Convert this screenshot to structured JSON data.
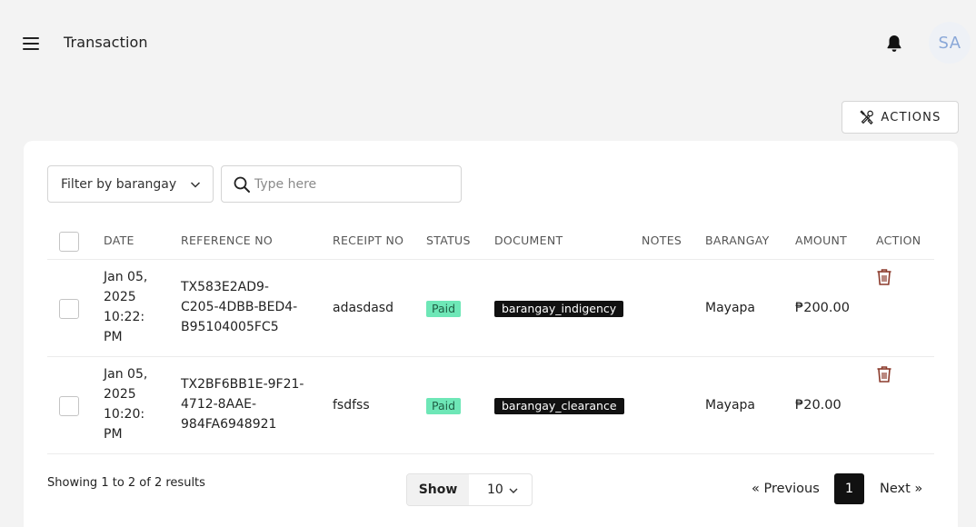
{
  "header": {
    "title": "Transaction",
    "avatar_initials": "SA"
  },
  "toolbar": {
    "actions_label": "ACTIONS"
  },
  "filters": {
    "barangay_select": "Filter by barangay",
    "search_placeholder": "Type here"
  },
  "table": {
    "columns": [
      "DATE",
      "REFERENCE NO",
      "RECEIPT NO",
      "STATUS",
      "DOCUMENT",
      "NOTES",
      "BARANGAY",
      "AMOUNT",
      "ACTION"
    ],
    "rows": [
      {
        "date": [
          "Jan 05,",
          "2025",
          "10:22:",
          "PM"
        ],
        "reference": [
          "TX583E2AD9-",
          "C205-4DBB-BED4-",
          "B95104005FC5"
        ],
        "receipt": "adasdasd",
        "status": "Paid",
        "document": "barangay_indigency",
        "notes": "",
        "barangay": "Mayapa",
        "amount": "₱200.00"
      },
      {
        "date": [
          "Jan 05,",
          "2025",
          "10:20:",
          "PM"
        ],
        "reference": [
          "TX2BF6BB1E-9F21-",
          "4712-8AAE-",
          "984FA6948921"
        ],
        "receipt": "fsdfss",
        "status": "Paid",
        "document": "barangay_clearance",
        "notes": "",
        "barangay": "Mayapa",
        "amount": "₱20.00"
      }
    ]
  },
  "footer": {
    "results_text": "Showing 1 to 2 of 2 results",
    "show_label": "Show",
    "page_size": "10",
    "prev_label": "« Previous",
    "current_page": "1",
    "next_label": "Next »"
  },
  "colors": {
    "status_paid_bg": "#6ee7b7",
    "document_badge_bg": "#111111",
    "trash_icon": "#8b3a2b",
    "avatar_text": "#8aa8d8"
  }
}
